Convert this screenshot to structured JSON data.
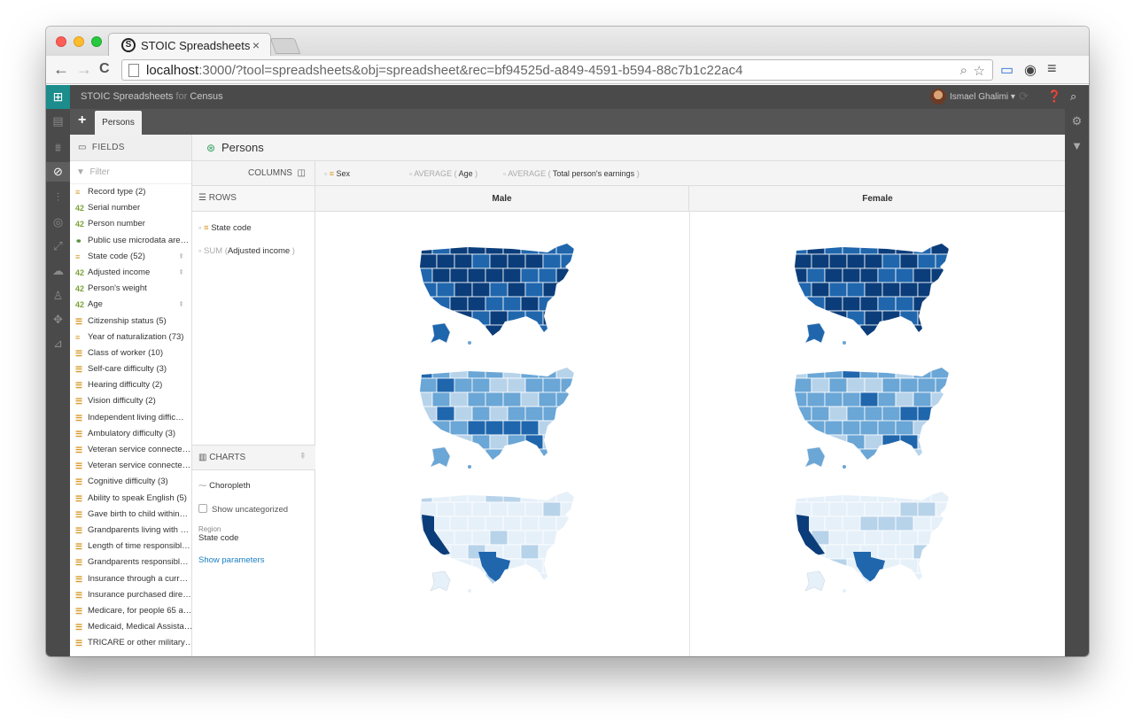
{
  "browser": {
    "tab_title": "STOIC Spreadsheets",
    "tab_close": "×",
    "url_host": "localhost",
    "url_rest": ":3000/?tool=spreadsheets&obj=spreadsheet&rec=bf94525d-a849-4591-b594-88c7b1c22ac4",
    "back": "←",
    "forward": "→",
    "reload": "C"
  },
  "appbar": {
    "title_main": "STOIC Spreadsheets",
    "title_for": " for ",
    "title_project": "Census",
    "user_name": "Ismael Ghalimi ▾"
  },
  "sheets": {
    "add": "+",
    "active_tab": "Persons"
  },
  "fields_panel": {
    "header": "FIELDS",
    "filter_placeholder": "Filter",
    "items": [
      {
        "type": "cat",
        "icon": "≡",
        "label": "Record type (2)",
        "pin": ""
      },
      {
        "type": "num",
        "icon": "42",
        "label": "Serial number",
        "pin": ""
      },
      {
        "type": "num",
        "icon": "42",
        "label": "Person number",
        "pin": ""
      },
      {
        "type": "geo",
        "icon": "⚭",
        "label": "Public use microdata are…",
        "pin": ""
      },
      {
        "type": "cat",
        "icon": "≡",
        "label": "State code (52)",
        "pin": "⇞"
      },
      {
        "type": "num",
        "icon": "42",
        "label": "Adjusted income",
        "pin": "⇞"
      },
      {
        "type": "num",
        "icon": "42",
        "label": "Person's weight",
        "pin": ""
      },
      {
        "type": "num",
        "icon": "42",
        "label": "Age",
        "pin": "⇞"
      },
      {
        "type": "cat",
        "icon": "☰",
        "label": "Citizenship status (5)",
        "pin": ""
      },
      {
        "type": "cat",
        "icon": "≡",
        "label": "Year of naturalization (73)",
        "pin": ""
      },
      {
        "type": "cat",
        "icon": "☰",
        "label": "Class of worker (10)",
        "pin": ""
      },
      {
        "type": "cat",
        "icon": "☰",
        "label": "Self-care difficulty (3)",
        "pin": ""
      },
      {
        "type": "cat",
        "icon": "☰",
        "label": "Hearing difficulty (2)",
        "pin": ""
      },
      {
        "type": "cat",
        "icon": "☰",
        "label": "Vision difficulty (2)",
        "pin": ""
      },
      {
        "type": "cat",
        "icon": "☰",
        "label": "Independent living diffic…",
        "pin": ""
      },
      {
        "type": "cat",
        "icon": "☰",
        "label": "Ambulatory difficulty (3)",
        "pin": ""
      },
      {
        "type": "cat",
        "icon": "☰",
        "label": "Veteran service connecte…",
        "pin": ""
      },
      {
        "type": "cat",
        "icon": "☰",
        "label": "Veteran service connecte…",
        "pin": ""
      },
      {
        "type": "cat",
        "icon": "☰",
        "label": "Cognitive difficulty (3)",
        "pin": ""
      },
      {
        "type": "cat",
        "icon": "☰",
        "label": "Ability to speak English (5)",
        "pin": ""
      },
      {
        "type": "cat",
        "icon": "☰",
        "label": "Gave birth to child within…",
        "pin": ""
      },
      {
        "type": "cat",
        "icon": "☰",
        "label": "Grandparents living with …",
        "pin": ""
      },
      {
        "type": "cat",
        "icon": "☰",
        "label": "Length of time responsibl…",
        "pin": ""
      },
      {
        "type": "cat",
        "icon": "☰",
        "label": "Grandparents responsibl…",
        "pin": ""
      },
      {
        "type": "cat",
        "icon": "☰",
        "label": "Insurance through a curr…",
        "pin": ""
      },
      {
        "type": "cat",
        "icon": "☰",
        "label": "Insurance purchased dire…",
        "pin": ""
      },
      {
        "type": "cat",
        "icon": "☰",
        "label": "Medicare, for people 65 a…",
        "pin": ""
      },
      {
        "type": "cat",
        "icon": "☰",
        "label": "Medicaid, Medical Assista…",
        "pin": ""
      },
      {
        "type": "cat",
        "icon": "☰",
        "label": "TRICARE or other military…",
        "pin": ""
      }
    ]
  },
  "content": {
    "title": "Persons",
    "columns_label": "COLUMNS",
    "rows_label": "ROWS",
    "row_fields": [
      {
        "prefix": "",
        "name": "State code",
        "suffix": ""
      },
      {
        "prefix": "SUM (",
        "name": "Adjusted income",
        "suffix": " )"
      }
    ],
    "column_fields": [
      {
        "prefix": "",
        "name": "Sex",
        "suffix": ""
      },
      {
        "prefix": "AVERAGE ( ",
        "name": "Age",
        "suffix": " )"
      },
      {
        "prefix": "AVERAGE ( ",
        "name": "Total person's earnings",
        "suffix": " )"
      }
    ],
    "charts_label": "CHARTS",
    "chart_type": "Choropleth",
    "show_uncategorized": "Show uncategorized",
    "region_label": "Region",
    "region_value": "State code",
    "show_parameters": "Show parameters",
    "col_headers": [
      "Male",
      "Female"
    ]
  },
  "colors": {
    "dark": "#0b3d7a",
    "mid_dark": "#1f66ad",
    "mid": "#6aa6d6",
    "light": "#b7d3ea",
    "pale": "#e6f0f9",
    "teal": "#1c8c8c"
  }
}
